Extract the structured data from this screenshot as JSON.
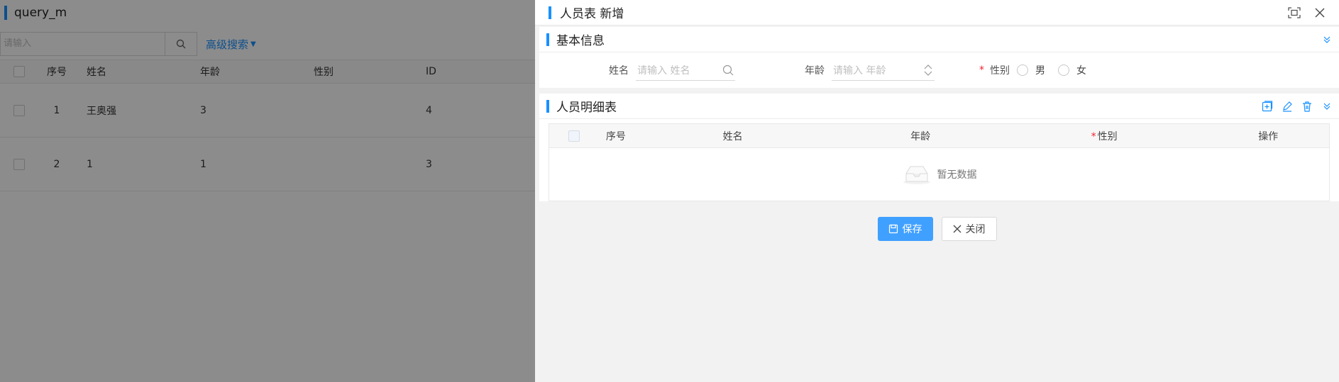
{
  "background": {
    "page_title": "query_m",
    "search": {
      "placeholder": "请输入",
      "search_icon": "search-icon",
      "advanced_label": "高级搜索"
    },
    "table": {
      "columns": [
        "序号",
        "姓名",
        "年龄",
        "性别",
        "ID"
      ],
      "rows": [
        {
          "no": "1",
          "name": "王奥强",
          "age": "3",
          "sex": "",
          "id": "4"
        },
        {
          "no": "2",
          "name": "1",
          "age": "1",
          "sex": "",
          "id": "3"
        }
      ]
    }
  },
  "drawer": {
    "title": "人员表 新增",
    "icons": {
      "fullscreen": "fullscreen-icon",
      "close": "close-icon"
    },
    "basic_section": {
      "title": "基本信息",
      "fields": {
        "name_label": "姓名",
        "name_placeholder": "请输入 姓名",
        "age_label": "年龄",
        "age_placeholder": "请输入 年龄",
        "sex_required": "*",
        "sex_label": "性别",
        "sex_options": [
          "男",
          "女"
        ]
      }
    },
    "detail_section": {
      "title": "人员明细表",
      "columns": [
        "序号",
        "姓名",
        "年龄",
        "性别",
        "操作"
      ],
      "required_mark": "*",
      "empty_text": "暂无数据",
      "icons": [
        "add-row-icon",
        "edit-icon",
        "delete-icon",
        "collapse-icon"
      ]
    },
    "footer": {
      "save_label": "保存",
      "close_label": "关闭"
    }
  },
  "colors": {
    "accent": "#1890ff",
    "primary_button": "#40a0ff",
    "required": "#f5222d",
    "mask": "rgba(0,0,0,0.45)"
  }
}
